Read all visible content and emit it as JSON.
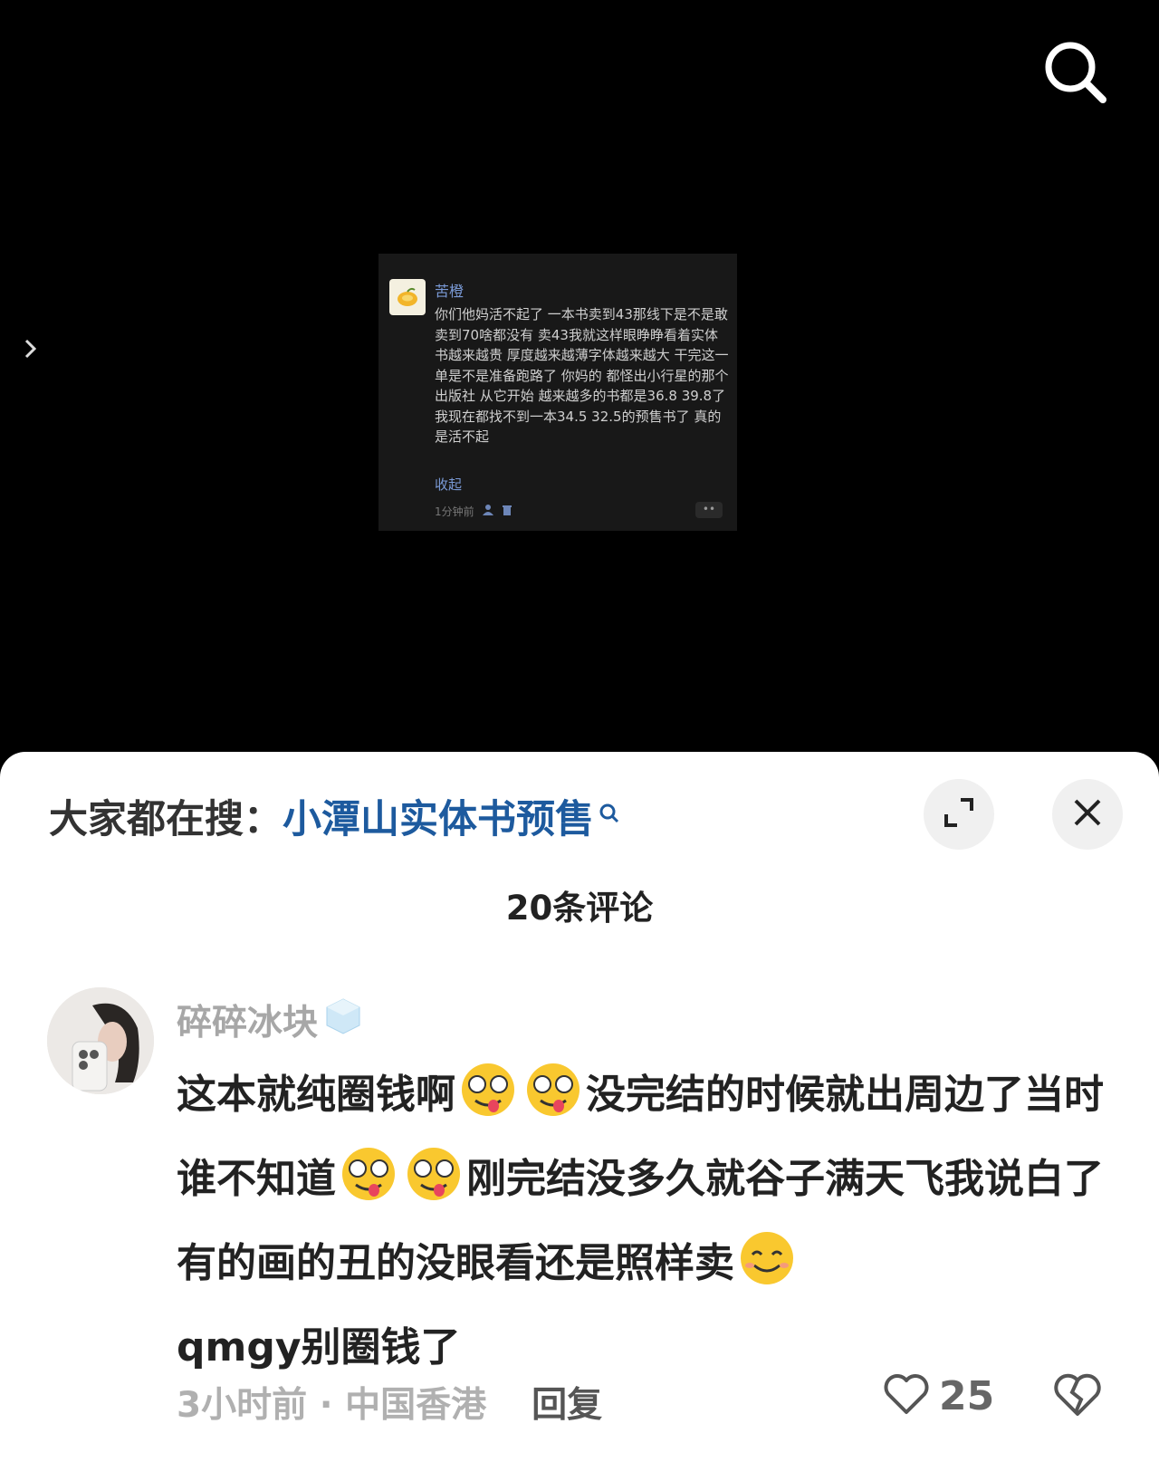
{
  "screenshot": {
    "username": "苦橙",
    "text": "你们他妈活不起了 一本书卖到43那线下是不是敢卖到70啥都没有 卖43我就这样眼睁睁看着实体书越来越贵 厚度越来越薄字体越来越大 干完这一单是不是准备跑路了 你妈的 都怪出小行星的那个出版社 从它开始 越来越多的书都是36.8 39.8了 我现在都找不到一本34.5 32.5的预售书了 真的是活不起",
    "collapse_label": "收起",
    "time": "1分钟前",
    "more_label": "••"
  },
  "sheet": {
    "search_prefix": "大家都在搜：",
    "search_keyword": "小潭山实体书预售",
    "comment_count_label": "20条评论"
  },
  "comment": {
    "username": "碎碎冰块",
    "text_part1": "这本就纯圈钱啊",
    "text_part2": "没完结的时候就出周边了当时谁不知道",
    "text_part3": "刚完结没多久就谷子满天飞我说白了有的画的丑的没眼看还是照样卖",
    "text_part4": "qmgy别圈钱了",
    "time": "3小时前",
    "separator": " · ",
    "location": "中国香港",
    "reply_label": "回复",
    "like_count": "25"
  },
  "colors": {
    "keyword_blue": "#1d5a9e",
    "sheet_bg": "#ffffff",
    "viewer_bg": "#000000"
  }
}
